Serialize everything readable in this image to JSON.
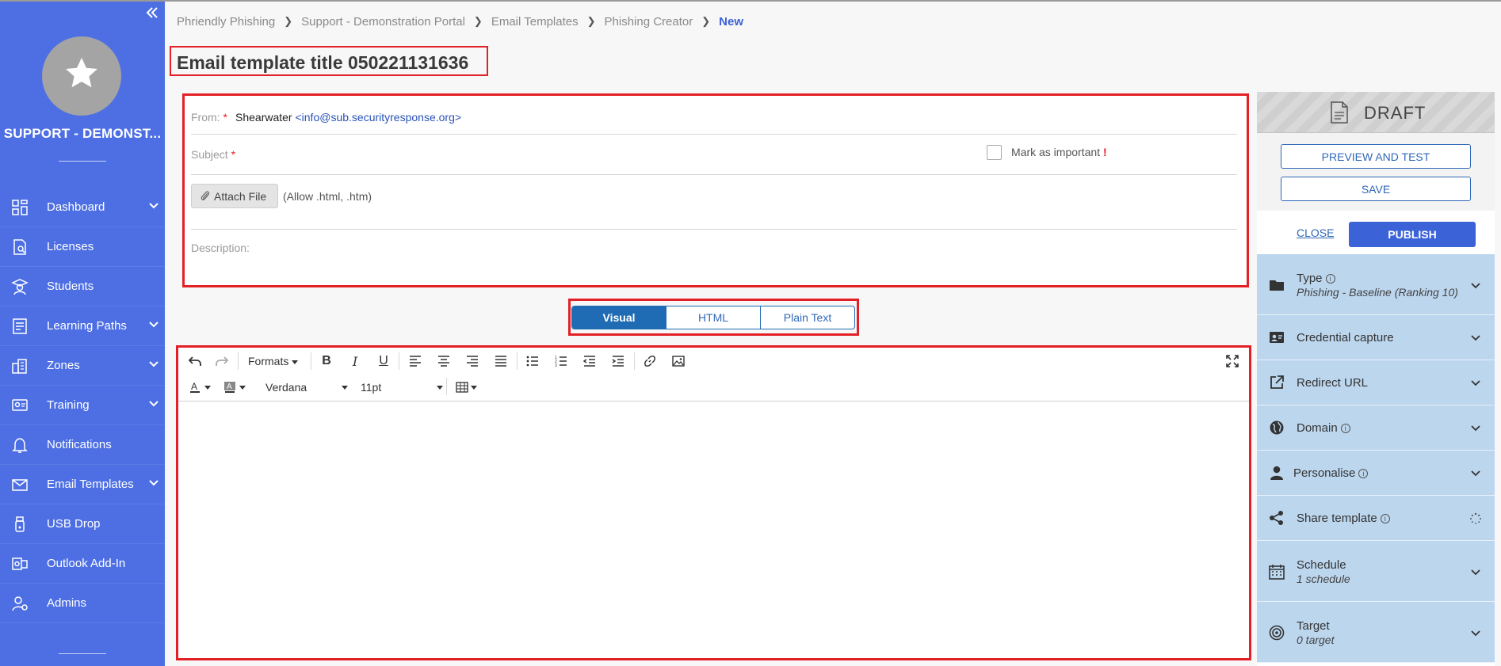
{
  "sidebar": {
    "org_name": "SUPPORT - DEMONST...",
    "items": [
      {
        "label": "Dashboard",
        "icon": "dashboard-icon",
        "expandable": true
      },
      {
        "label": "Licenses",
        "icon": "licenses-icon",
        "expandable": false
      },
      {
        "label": "Students",
        "icon": "students-icon",
        "expandable": false
      },
      {
        "label": "Learning Paths",
        "icon": "learning-paths-icon",
        "expandable": true
      },
      {
        "label": "Zones",
        "icon": "zones-icon",
        "expandable": true
      },
      {
        "label": "Training",
        "icon": "training-icon",
        "expandable": true
      },
      {
        "label": "Notifications",
        "icon": "bell-icon",
        "expandable": false
      },
      {
        "label": "Email Templates",
        "icon": "envelope-icon",
        "expandable": true
      },
      {
        "label": "USB Drop",
        "icon": "usb-icon",
        "expandable": false
      },
      {
        "label": "Outlook Add-In",
        "icon": "outlook-icon",
        "expandable": false
      },
      {
        "label": "Admins",
        "icon": "admins-icon",
        "expandable": false
      }
    ]
  },
  "breadcrumb": [
    "Phriendly Phishing",
    "Support - Demonstration Portal",
    "Email Templates",
    "Phishing Creator",
    "New"
  ],
  "page_title": "Email template title 050221131636",
  "header": {
    "from_label": "From:",
    "from_name": "Shearwater",
    "from_email": "<info@sub.securityresponse.org>",
    "subject_label": "Subject",
    "subject_value": "",
    "important_label": "Mark as important",
    "important_mark": "!",
    "important_checked": false,
    "attach_label": "Attach File",
    "attach_hint": "(Allow .html, .htm)",
    "description_label": "Description:",
    "description_value": ""
  },
  "editor_tabs": {
    "items": [
      "Visual",
      "HTML",
      "Plain Text"
    ],
    "active": "Visual"
  },
  "editor": {
    "formats_label": "Formats",
    "font_family": "Verdana",
    "font_size": "11pt",
    "content": ""
  },
  "right_panel": {
    "status": "DRAFT",
    "preview_label": "PREVIEW AND TEST",
    "save_label": "SAVE",
    "close_label": "CLOSE",
    "publish_label": "PUBLISH",
    "sections": [
      {
        "title": "Type",
        "info": true,
        "sub": "Phishing - Baseline (Ranking 10)"
      },
      {
        "title": "Credential capture",
        "info": false,
        "sub": ""
      },
      {
        "title": "Redirect URL",
        "info": false,
        "sub": ""
      },
      {
        "title": "Domain",
        "info": true,
        "sub": ""
      },
      {
        "title": "Personalise",
        "info": true,
        "sub": ""
      },
      {
        "title": "Share template",
        "info": true,
        "sub": ""
      },
      {
        "title": "Schedule",
        "info": false,
        "sub": "1 schedule"
      },
      {
        "title": "Target",
        "info": false,
        "sub": "0 target"
      }
    ]
  },
  "colors": {
    "sidebar": "#4d6fe3",
    "accent": "#3c62d8",
    "tab_active": "#1f6cb5",
    "section_bg": "#bcd6ee",
    "highlight": "#e32026"
  }
}
